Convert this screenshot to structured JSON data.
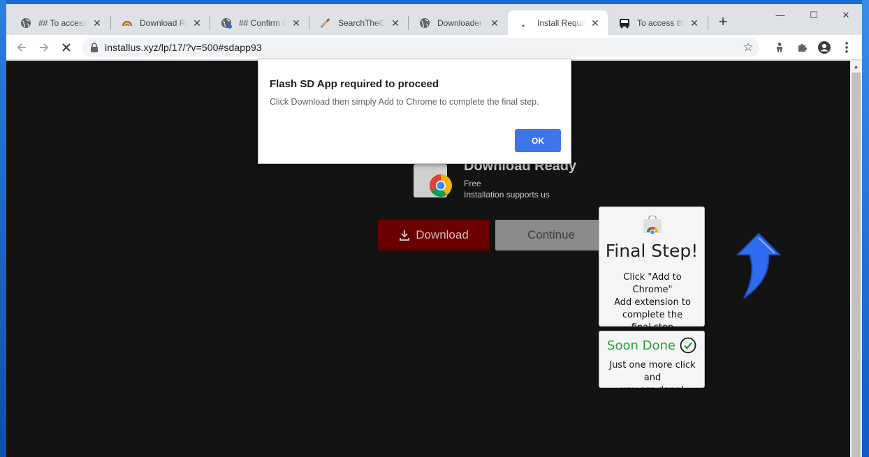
{
  "browser": {
    "tabs": [
      {
        "title": "## To access the",
        "icon": "globe-icon"
      },
      {
        "title": "Download Ready",
        "icon": "rainbow-icon"
      },
      {
        "title": "## Confirm notifications",
        "icon": "globe-badge-icon"
      },
      {
        "title": "SearchTheCorrect",
        "icon": "feather-icon"
      },
      {
        "title": "Downloader",
        "icon": "globe-icon"
      },
      {
        "title": "Install Required",
        "icon": "loading-icon",
        "active": true
      },
      {
        "title": "To access the video",
        "icon": "bus-icon"
      }
    ],
    "new_tab_label": "+",
    "window_controls": {
      "minimize": "—",
      "maximize": "☐",
      "close": "✕"
    },
    "url": "installus.xyz/lp/17/?v=500#sdapp93"
  },
  "page": {
    "card": {
      "heading": "Download Ready",
      "sub1": "Free",
      "sub2": "Installation supports us"
    },
    "download_label": "Download",
    "continue_label": "Continue",
    "final_step": {
      "title": "Final Step!",
      "line1": "Click \"Add to Chrome\"",
      "line2": "Add extension to",
      "line3": "complete the",
      "line4": "final step"
    },
    "soon_done": {
      "title": "Soon Done",
      "line1": "Just one more click and",
      "line2": "you are done!"
    }
  },
  "dialog": {
    "title": "Flash SD App required to proceed",
    "message": "Click Download then simply Add to Chrome to complete the final step.",
    "ok_label": "OK"
  },
  "colors": {
    "accent_blue": "#3e76ea",
    "download_red": "#6a0000",
    "done_green": "#2e9a3d",
    "arrow_blue": "#2f6cf2"
  }
}
